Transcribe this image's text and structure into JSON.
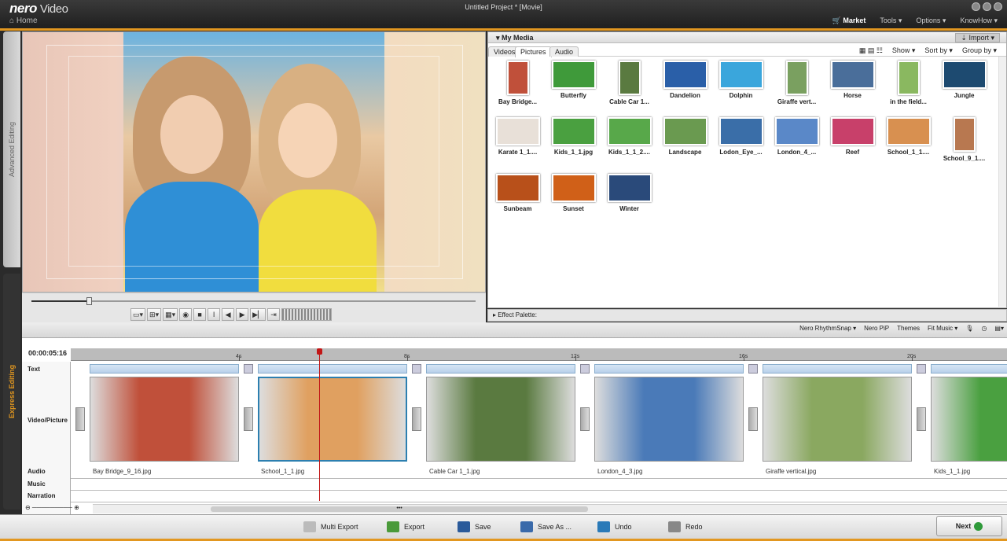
{
  "titlebar": {
    "logo": "nero",
    "app_name": "Video",
    "home": "Home",
    "window_title": "Untitled Project * [Movie]",
    "menu": {
      "market": "Market",
      "tools": "Tools ▾",
      "options": "Options ▾",
      "knowhow": "KnowHow ▾"
    }
  },
  "side_tabs": {
    "advanced": "Advanced Editing",
    "express": "Express Editing"
  },
  "preview": {
    "scrub_position": 0.13
  },
  "media": {
    "header": "My Media",
    "import": "Import ▾",
    "tabs": [
      "Videos",
      "Pictures",
      "Audio"
    ],
    "active_tab": "Pictures",
    "view_options": {
      "show": "Show ▾",
      "sort": "Sort by ▾",
      "group": "Group by ▾"
    },
    "items": [
      {
        "label": "Bay Bridge...",
        "color": "#c0503a",
        "portrait": true
      },
      {
        "label": "Butterfly",
        "color": "#3f9a3a",
        "portrait": false
      },
      {
        "label": "Cable Car 1...",
        "color": "#5a7a40",
        "portrait": true
      },
      {
        "label": "Dandelion",
        "color": "#2a5fa8",
        "portrait": false
      },
      {
        "label": "Dolphin",
        "color": "#3aa6dc",
        "portrait": false
      },
      {
        "label": "Giraffe vert...",
        "color": "#7aa060",
        "portrait": true
      },
      {
        "label": "Horse",
        "color": "#4a6e9a",
        "portrait": false
      },
      {
        "label": "in the field...",
        "color": "#8ab860",
        "portrait": true
      },
      {
        "label": "Jungle",
        "color": "#1d4a70",
        "portrait": false
      },
      {
        "label": "Karate 1_1....",
        "color": "#e8e0d8",
        "portrait": false
      },
      {
        "label": "Kids_1_1.jpg",
        "color": "#4aa040",
        "portrait": false
      },
      {
        "label": "Kids_1_1_2....",
        "color": "#58a84a",
        "portrait": false
      },
      {
        "label": "Landscape",
        "color": "#6a9a50",
        "portrait": false
      },
      {
        "label": "Lodon_Eye_...",
        "color": "#3a6ea8",
        "portrait": false
      },
      {
        "label": "London_4_...",
        "color": "#5a88c8",
        "portrait": false
      },
      {
        "label": "Reef",
        "color": "#c8406a",
        "portrait": false
      },
      {
        "label": "School_1_1....",
        "color": "#d89050",
        "portrait": false
      },
      {
        "label": "School_9_1....",
        "color": "#b87850",
        "portrait": true
      },
      {
        "label": "Sunbeam",
        "color": "#b8501a",
        "portrait": false
      },
      {
        "label": "Sunset",
        "color": "#d06018",
        "portrait": false
      },
      {
        "label": "Winter",
        "color": "#2a4a7a",
        "portrait": false
      }
    ]
  },
  "effect_palette": "Effect Palette:",
  "timeline_tools": {
    "rhythm": "Nero RhythmSnap ▾",
    "pip": "Nero PiP",
    "themes": "Themes",
    "fitmusic": "Fit Music ▾"
  },
  "timeline": {
    "timecode": "00:00:05:16",
    "ruler": [
      "4s",
      "8s",
      "12s",
      "16s",
      "20s"
    ],
    "track_labels": {
      "text": "Text",
      "video": "Video/Picture",
      "audio": "Audio",
      "music": "Music",
      "narration": "Narration"
    },
    "clips": [
      {
        "name": "Bay Bridge_9_16.jpg",
        "color": "#c0503a"
      },
      {
        "name": "School_1_1.jpg",
        "color": "#e0a060"
      },
      {
        "name": "Cable Car 1_1.jpg",
        "color": "#5a7a40"
      },
      {
        "name": "London_4_3.jpg",
        "color": "#4a7ab8"
      },
      {
        "name": "Giraffe vertical.jpg",
        "color": "#8aa860"
      },
      {
        "name": "Kids_1_1.jpg",
        "color": "#4aa040"
      }
    ],
    "selected_clip": 1
  },
  "bottom": {
    "multi_export": "Multi Export",
    "export": "Export",
    "save": "Save",
    "save_as": "Save As ...",
    "undo": "Undo",
    "redo": "Redo",
    "next": "Next"
  }
}
